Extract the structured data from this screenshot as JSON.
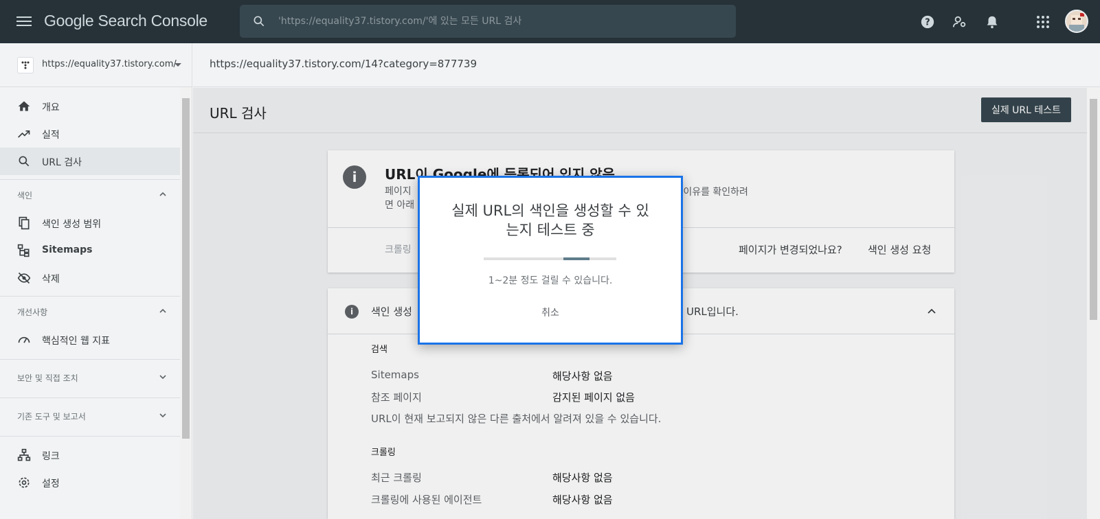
{
  "topbar": {
    "brand": "Google Search Console",
    "search_placeholder": "'https://equality37.tistory.com/'에 있는 모든 URL 검사",
    "icons": [
      "menu-icon",
      "help-icon",
      "manage-users-icon",
      "bell-icon",
      "apps-icon",
      "avatar"
    ]
  },
  "sidebar": {
    "property": "https://equality37.tistory.com/",
    "items": [
      {
        "label": "개요",
        "icon": "home-icon"
      },
      {
        "label": "실적",
        "icon": "trending-up-icon"
      },
      {
        "label": "URL 검사",
        "icon": "search-icon"
      }
    ],
    "index_section": {
      "title": "색인",
      "items": [
        {
          "label": "색인 생성 범위",
          "icon": "copy-icon"
        },
        {
          "label": "Sitemaps",
          "icon": "sitemap-icon"
        },
        {
          "label": "삭제",
          "icon": "eye-off-icon"
        }
      ]
    },
    "enhance_section": {
      "title": "개선사항",
      "items": [
        {
          "label": "핵심적인 웹 지표",
          "icon": "speed-icon"
        }
      ]
    },
    "security_section": {
      "title": "보안 및 직접 조치"
    },
    "legacy_section": {
      "title": "기존 도구 및 보고서"
    },
    "bottom_items": [
      {
        "label": "링크",
        "icon": "links-icon"
      },
      {
        "label": "설정",
        "icon": "settings-icon"
      }
    ]
  },
  "main": {
    "inspected_url": "https://equality37.tistory.com/14?category=877739",
    "page_title": "URL 검사",
    "live_test_label": "실제 URL 테스트",
    "card1": {
      "title": "URL이 Google에 등록되어 있지 않음",
      "desc_left": "페이지",
      "desc_left2": "면 아래",
      "desc_right": "은 이유를 확인하려",
      "crawl_hint": "크롤링",
      "question": "페이지가 변경되었나요?",
      "request": "색인 생성 요청"
    },
    "card2": {
      "head_left": "색인 생성",
      "head_right": "URL입니다.",
      "search_section": "검색",
      "rows1": [
        {
          "key": "Sitemaps",
          "value": "해당사항 없음"
        },
        {
          "key": "참조 페이지",
          "value": "감지된 페이지 없음"
        }
      ],
      "note": "URL이 현재 보고되지 않은 다른 출처에서 알려져 있을 수 있습니다.",
      "crawl_section": "크롤링",
      "rows2": [
        {
          "key": "최근 크롤링",
          "value": "해당사항 없음"
        },
        {
          "key": "크롤링에 사용된 에이전트",
          "value": "해당사항 없음"
        }
      ]
    }
  },
  "dialog": {
    "title_line1": "실제 URL의 색인을 생성할 수 있",
    "title_line2": "는지 테스트 중",
    "progress": 0.8,
    "note": "1~2분 정도 걸릴 수 있습니다.",
    "cancel_label": "취소",
    "border_color": "#1a73e8"
  }
}
